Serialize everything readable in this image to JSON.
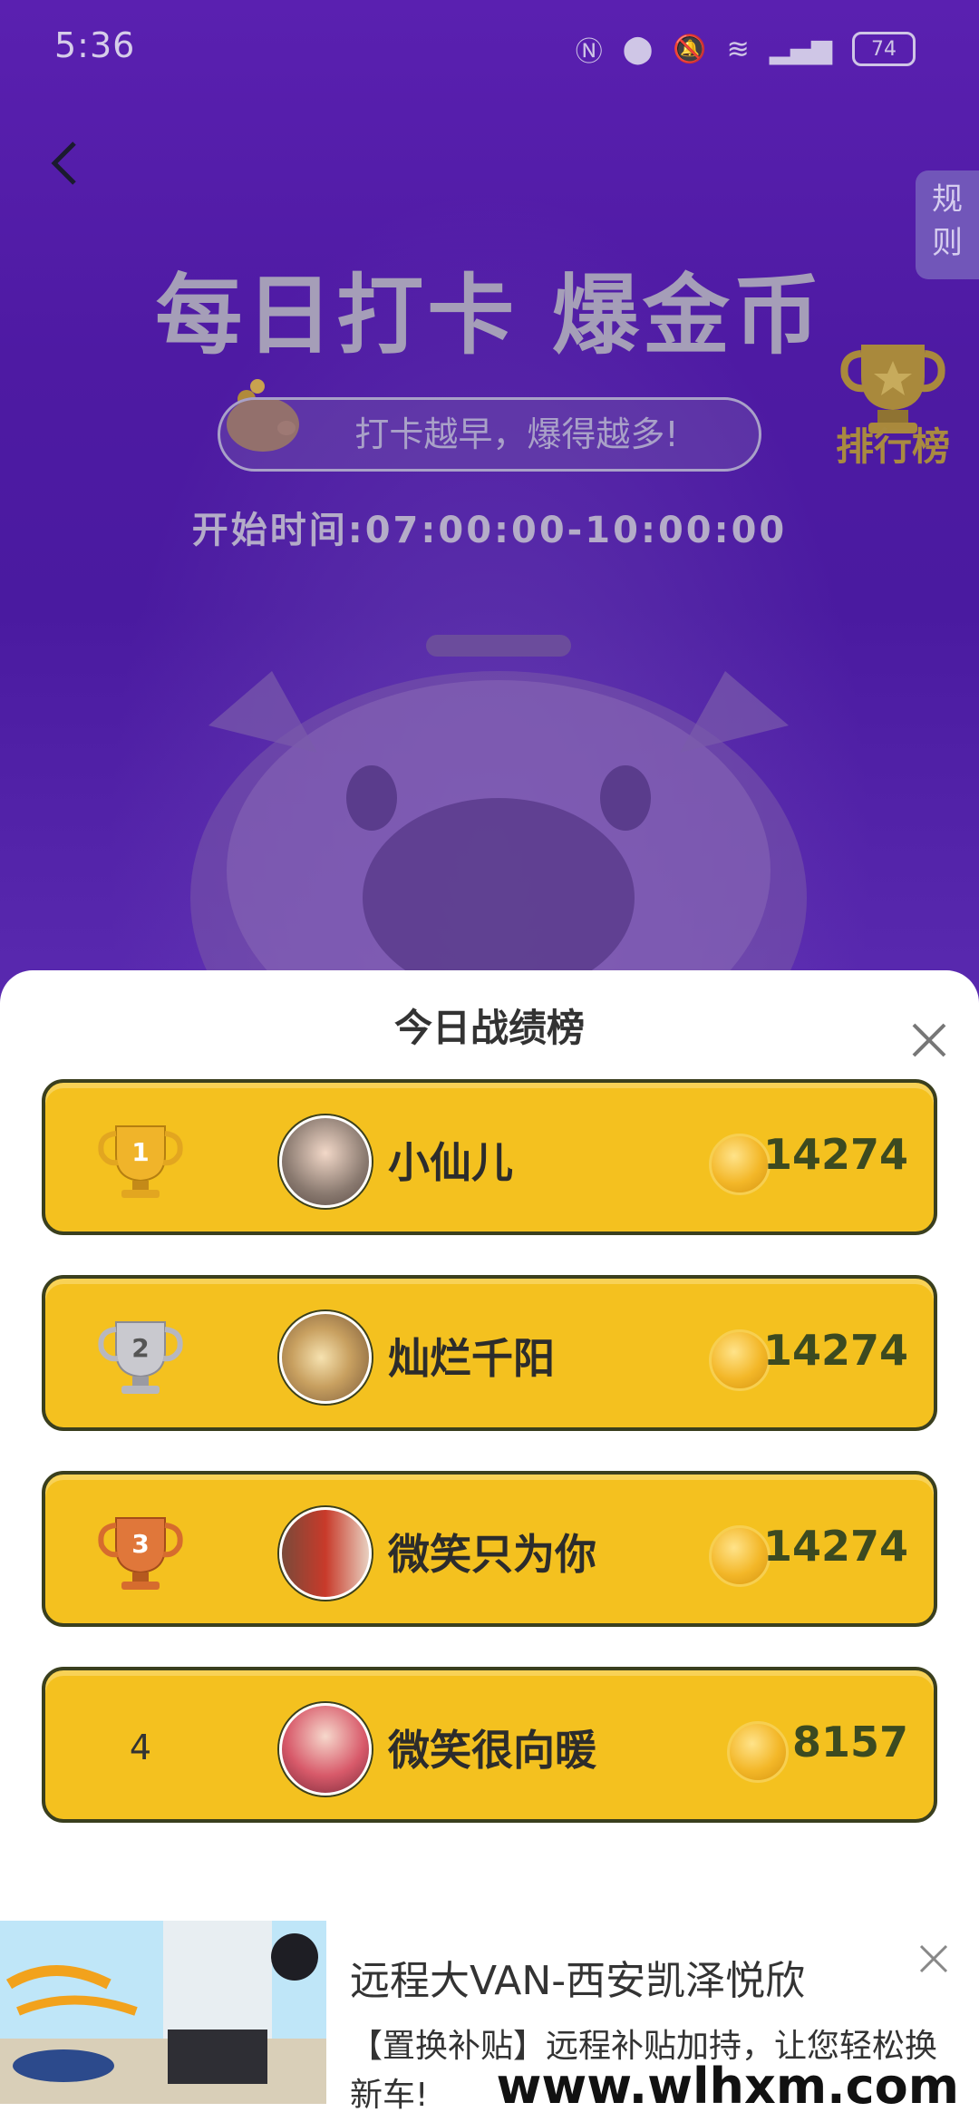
{
  "status_bar": {
    "time": "5:36",
    "battery": "74"
  },
  "header": {
    "rules_label": [
      "规",
      "则"
    ],
    "title": "每日打卡 爆金币",
    "slogan": "打卡越早，爆得越多!",
    "rank_label": "排行榜",
    "start_time": "开始时间:07:00:00-10:00:00"
  },
  "sheet": {
    "title": "今日战绩榜",
    "rows": [
      {
        "rank": "1",
        "name": "小仙儿",
        "score": "14274"
      },
      {
        "rank": "2",
        "name": "灿烂千阳",
        "score": "14274"
      },
      {
        "rank": "3",
        "name": "微笑只为你",
        "score": "14274"
      },
      {
        "rank": "4",
        "name": "微笑很向暖",
        "score": "8157"
      }
    ]
  },
  "ad": {
    "title": "远程大VAN-西安凯泽悦欣",
    "desc": "【置换补贴】远程补贴加持，让您轻松换新车!",
    "watermark": "www.wlhxm.com"
  },
  "colors": {
    "header_bg": "#4e1aa3",
    "row_bg": "#f4c11f",
    "row_border": "#3a3f1e",
    "score": "#3c4a20"
  }
}
